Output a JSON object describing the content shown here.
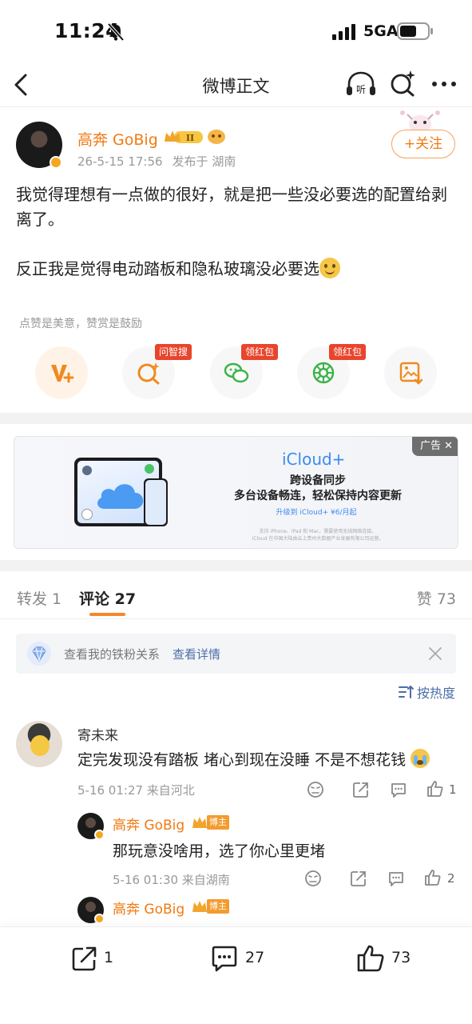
{
  "status_bar": {
    "time": "11:24",
    "network": "5GA"
  },
  "nav": {
    "title": "微博正文"
  },
  "post": {
    "author_name": "高奔 GoBig",
    "date": "26-5-15 17:56",
    "location": "发布于 湖南",
    "follow_label": "+关注",
    "paragraph_1": "我觉得理想有一点做的很好，就是把一些没必要选的配置给剥离了。",
    "paragraph_2": "反正我是觉得电动踏板和隐私玻璃没必要选",
    "reward_hint": "点赞是美意，赞赏是鼓励",
    "action_tags": {
      "ask": "问智搜",
      "wechat": "领红包",
      "moments": "领红包"
    }
  },
  "ad": {
    "label": "广告 ✕",
    "brand": "iCloud+",
    "headline": "跨设备同步",
    "subline": "多台设备畅连，轻松保持内容更新",
    "cta": "升级到 iCloud+ ¥6/月起",
    "fine_print_1": "支持 iPhone、iPad 和 Mac，需要使用无线网络连接。",
    "fine_print_2": "iCloud 在中国大陆由云上贵州大数据产业发展有限公司运营。"
  },
  "tabs": {
    "repost": "转发 1",
    "comments": "评论 27",
    "likes": "赞 73"
  },
  "fan_banner": {
    "text": "查看我的铁粉关系",
    "link": "查看详情"
  },
  "sort": {
    "label": "按热度"
  },
  "comments": [
    {
      "name": "寄未来",
      "text": "定完发现没有踏板 堵心到现在没睡 不是不想花钱",
      "meta": "5-16 01:27  来自河北",
      "likes": "1"
    }
  ],
  "replies": [
    {
      "name": "高奔 GoBig",
      "tag": "博主",
      "text": "那玩意没啥用，选了你心里更堵",
      "meta": "5-16 01:30  来自湖南",
      "likes": "2"
    },
    {
      "name": "高奔 GoBig",
      "tag": "博主"
    }
  ],
  "bottom_bar": {
    "reposts": "1",
    "comments": "27",
    "likes": "73"
  },
  "colors": {
    "accent": "#f07a12",
    "link": "#4b6ea8",
    "tag_red": "#e8452c"
  }
}
